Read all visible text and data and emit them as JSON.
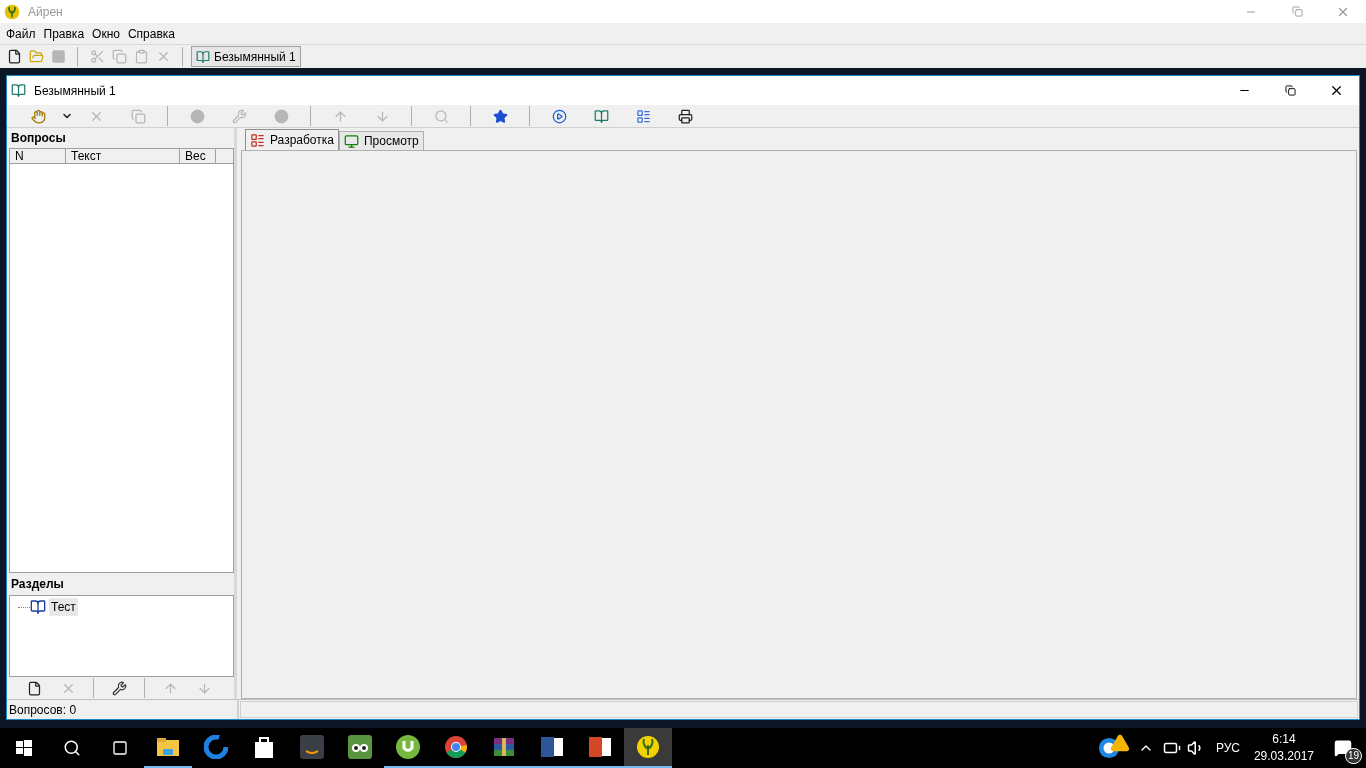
{
  "app_window": {
    "title": "Айрен"
  },
  "menu": [
    "Файл",
    "Правка",
    "Окно",
    "Справка"
  ],
  "main_toolbar": [
    {
      "kind": "new",
      "disabled": false
    },
    {
      "kind": "open",
      "disabled": false
    },
    {
      "kind": "save",
      "disabled": true
    },
    {
      "kind": "sep"
    },
    {
      "kind": "cut",
      "disabled": true
    },
    {
      "kind": "copy",
      "disabled": true
    },
    {
      "kind": "paste",
      "disabled": true
    },
    {
      "kind": "delete",
      "disabled": true
    },
    {
      "kind": "sep"
    }
  ],
  "window_buttons": [
    {
      "label": "Безымянный 1",
      "selected": true
    }
  ],
  "document_window": {
    "title": "Безымянный 1",
    "toolbar": [
      {
        "kind": "pointer",
        "disabled": false
      },
      {
        "kind": "dropdown",
        "disabled": false
      },
      {
        "kind": "delete",
        "disabled": true
      },
      {
        "kind": "copy",
        "disabled": true
      },
      {
        "kind": "sep"
      },
      {
        "kind": "circle",
        "disabled": true
      },
      {
        "kind": "tools",
        "disabled": true
      },
      {
        "kind": "circle",
        "disabled": true
      },
      {
        "kind": "sep"
      },
      {
        "kind": "up",
        "disabled": true
      },
      {
        "kind": "down",
        "disabled": true
      },
      {
        "kind": "sep"
      },
      {
        "kind": "search",
        "disabled": true
      },
      {
        "kind": "sep"
      },
      {
        "kind": "star",
        "disabled": false
      },
      {
        "kind": "sep"
      },
      {
        "kind": "play",
        "disabled": false
      },
      {
        "kind": "book",
        "disabled": false
      },
      {
        "kind": "html",
        "disabled": false
      },
      {
        "kind": "print",
        "disabled": false
      }
    ],
    "questions": {
      "title": "Вопросы",
      "columns": [
        "N",
        "Текст",
        "Вес"
      ]
    },
    "sections": {
      "title": "Разделы",
      "tree": [
        {
          "label": "Тест",
          "selected": true
        }
      ],
      "toolbar": [
        {
          "kind": "new",
          "disabled": false
        },
        {
          "kind": "delete",
          "disabled": true
        },
        {
          "kind": "sep"
        },
        {
          "kind": "tools",
          "disabled": false
        },
        {
          "kind": "sep"
        },
        {
          "kind": "up",
          "disabled": true
        },
        {
          "kind": "down",
          "disabled": true
        }
      ]
    },
    "tabs": [
      {
        "label": "Разработка",
        "kind": "design",
        "selected": true
      },
      {
        "label": "Просмотр",
        "kind": "preview",
        "selected": false
      }
    ],
    "status_bar": [
      "Вопросов: 0"
    ]
  },
  "taskbar": {
    "apps": [
      {
        "kind": "explorer",
        "running": true,
        "selected": false
      },
      {
        "kind": "edge",
        "running": false,
        "selected": false
      },
      {
        "kind": "store",
        "running": false,
        "selected": false
      },
      {
        "kind": "amazon",
        "running": false,
        "selected": false
      },
      {
        "kind": "tripadvisor",
        "running": false,
        "selected": false
      },
      {
        "kind": "utorrent",
        "running": true,
        "selected": false
      },
      {
        "kind": "chrome",
        "running": true,
        "selected": false
      },
      {
        "kind": "winrar",
        "running": true,
        "selected": false
      },
      {
        "kind": "word",
        "running": true,
        "selected": false
      },
      {
        "kind": "powerpoint",
        "running": true,
        "selected": false
      },
      {
        "kind": "airen",
        "running": true,
        "selected": true
      }
    ],
    "language": "РУС",
    "time": "6:14",
    "date": "29.03.2017",
    "notifications": "19"
  }
}
